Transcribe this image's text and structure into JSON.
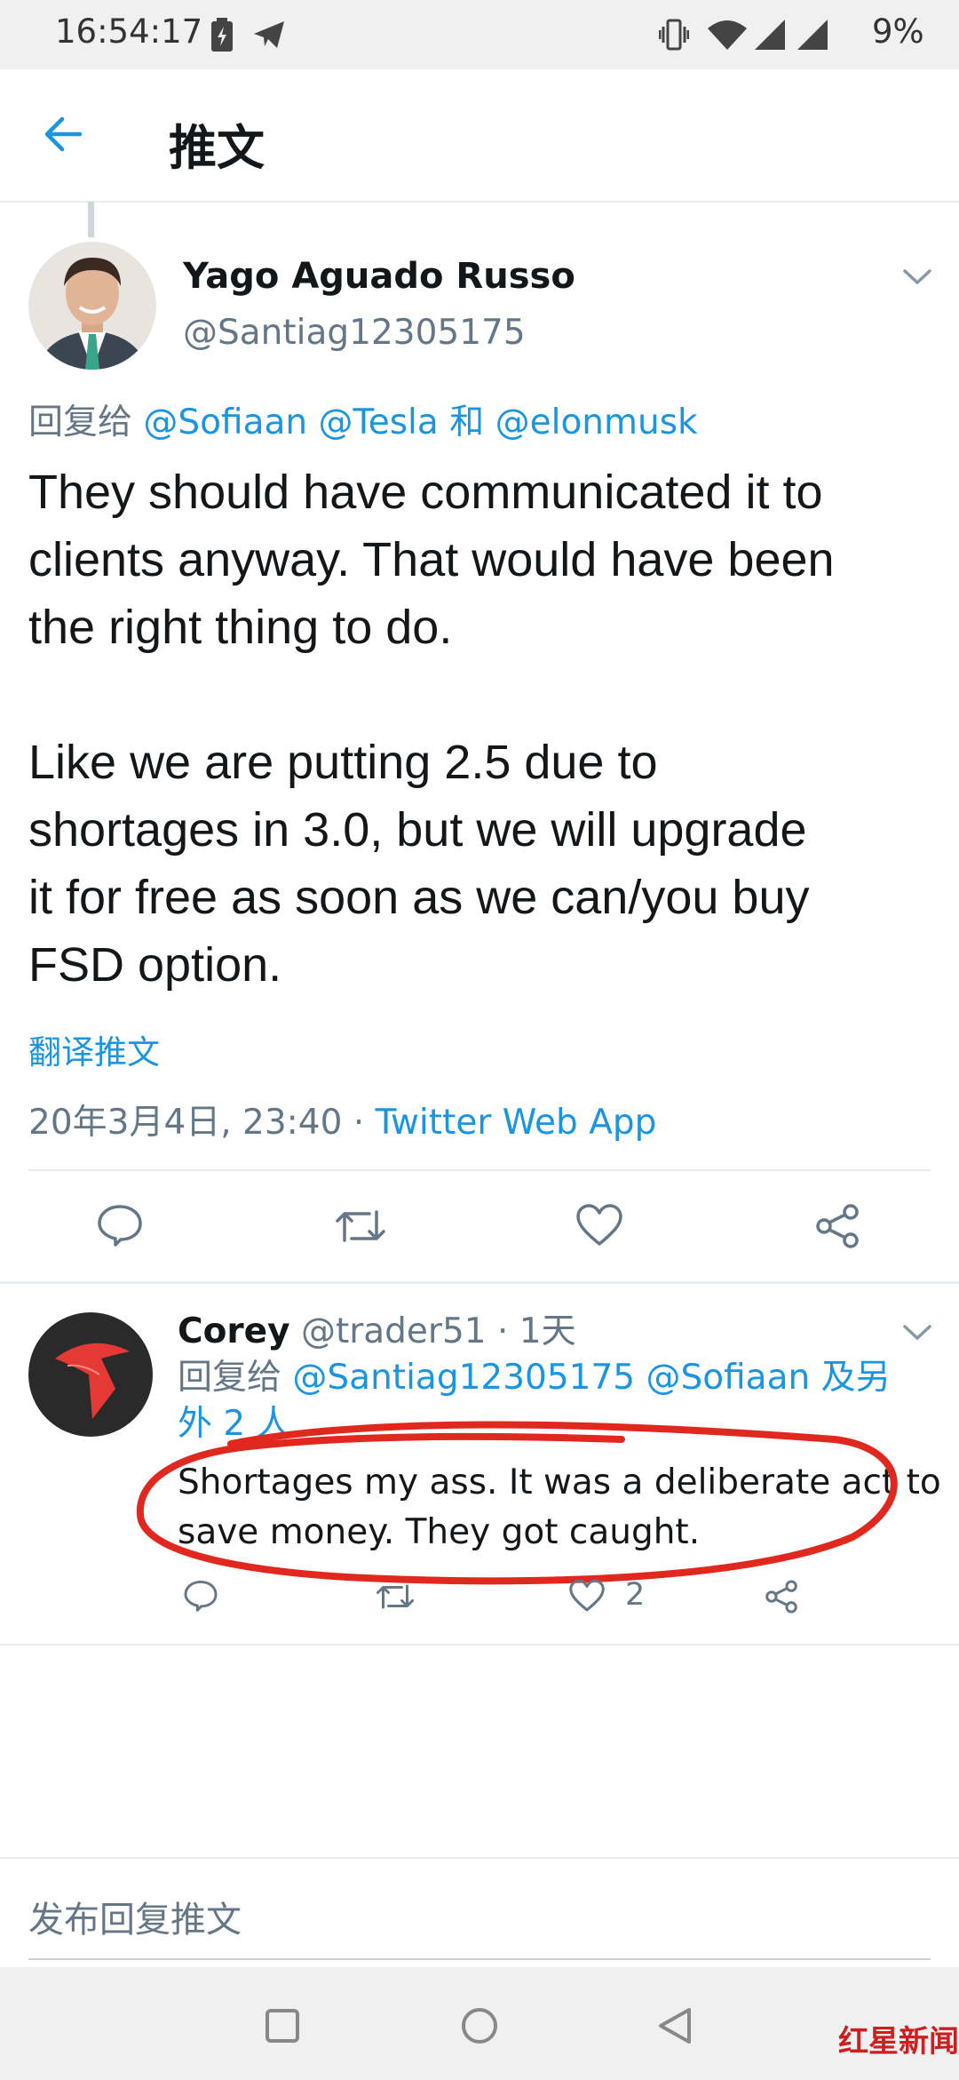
{
  "status_bar": {
    "time": "16:54:17",
    "battery": "9%"
  },
  "header": {
    "title": "推文"
  },
  "main_tweet": {
    "display_name": "Yago Aguado Russo",
    "handle": "@Santiag12305175",
    "reply_prefix": "回复给",
    "reply_mentions": [
      "@Sofiaan",
      "@Tesla",
      "和",
      "@elonmusk"
    ],
    "text_paragraph1_lines": [
      "They should have communicated it to",
      "clients anyway. That would have been",
      "the right thing to do."
    ],
    "text_paragraph2_lines": [
      "Like we are putting 2.5 due to",
      "shortages in 3.0, but we will upgrade",
      "it for free as soon as we can/you buy",
      "FSD option."
    ],
    "translate_label": "翻译推文",
    "timestamp": "20年3月4日, 23:40",
    "separator": "·",
    "source": "Twitter Web App"
  },
  "reply_tweet": {
    "display_name": "Corey",
    "handle": "@trader51",
    "time_ago": "· 1天",
    "reply_prefix": "回复给",
    "reply_mentions": [
      "@Santiag12305175",
      "@Sofiaan",
      "及另外"
    ],
    "reply_more": "2 人",
    "text_lines": [
      "Shortages my ass. It was a deliberate act to",
      "save money. They got caught."
    ],
    "like_count": "2"
  },
  "compose": {
    "placeholder": "发布回复推文"
  },
  "watermark": {
    "text": "红星新闻"
  },
  "colors": {
    "accent": "#1b95e0",
    "text": "#14171a",
    "muted": "#657786",
    "annotation": "#e0281e"
  }
}
